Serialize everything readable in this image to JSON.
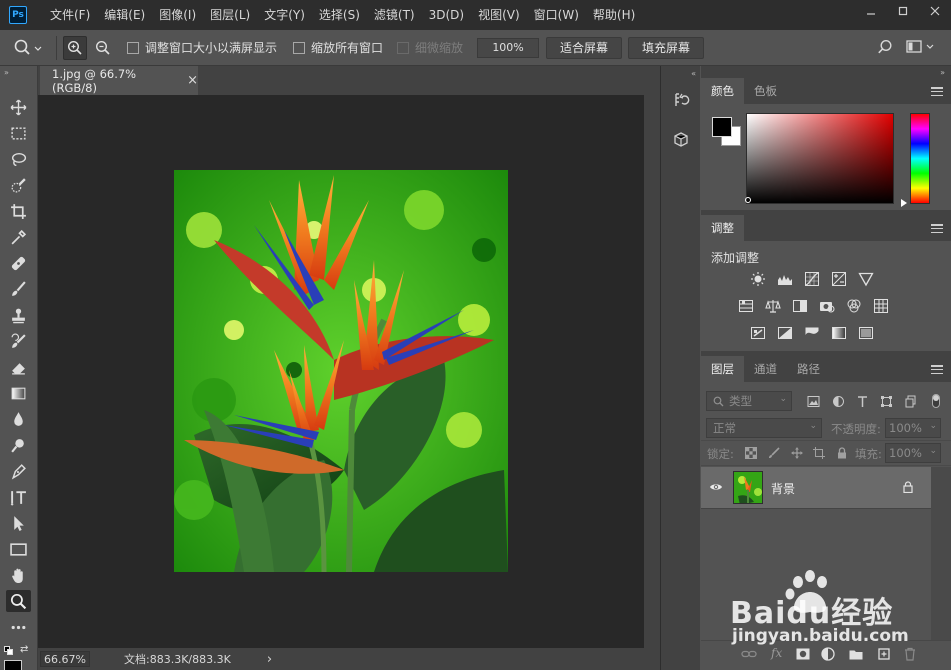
{
  "app": {
    "logo_text": "Ps"
  },
  "menu": [
    "文件(F)",
    "编辑(E)",
    "图像(I)",
    "图层(L)",
    "文字(Y)",
    "选择(S)",
    "滤镜(T)",
    "3D(D)",
    "视图(V)",
    "窗口(W)",
    "帮助(H)"
  ],
  "options": {
    "resize_windows_label": "调整窗口大小以满屏显示",
    "zoom_all_label": "缩放所有窗口",
    "scrubby_zoom_label": "细微缩放",
    "zoom_value": "100%",
    "fit_screen_label": "适合屏幕",
    "fill_screen_label": "填充屏幕"
  },
  "document": {
    "tab_title": "1.jpg @ 66.7%(RGB/8)",
    "close_glyph": "×"
  },
  "status": {
    "zoom": "66.67%",
    "doc_info": "文档:883.3K/883.3K",
    "arrow": "›"
  },
  "color_panel": {
    "tabs": [
      "颜色",
      "色板"
    ],
    "foreground": "#000000",
    "background": "#ffffff"
  },
  "adjust_panel": {
    "tab": "调整",
    "title": "添加调整"
  },
  "layers_panel": {
    "tabs": [
      "图层",
      "通道",
      "路径"
    ],
    "filter_placeholder": "类型",
    "blend_mode": "正常",
    "opacity_label": "不透明度:",
    "opacity_value": "100%",
    "lock_label": "锁定:",
    "fill_label": "填充:",
    "fill_value": "100%",
    "layer_name": "背景"
  },
  "watermark": {
    "brand": "Baidu经验",
    "url": "jingyan.baidu.com"
  }
}
